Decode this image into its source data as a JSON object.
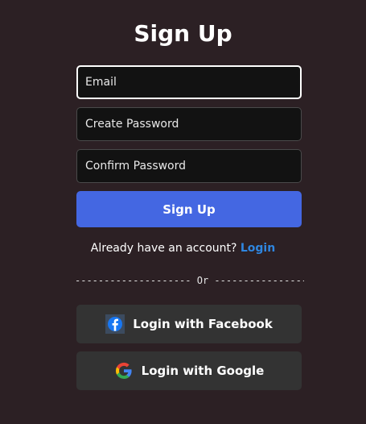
{
  "title": "Sign Up",
  "form": {
    "email_placeholder": "Email",
    "password_placeholder": "Create Password",
    "confirm_placeholder": "Confirm Password",
    "submit_label": "Sign Up"
  },
  "account": {
    "prompt": "Already have an account?",
    "login_link": "Login"
  },
  "divider": {
    "left": "--------------------",
    "text": "Or",
    "right": "--------------------"
  },
  "social": {
    "facebook_label": "Login with Facebook",
    "facebook_icon": "facebook-icon",
    "google_label": "Login with Google",
    "google_icon": "google-icon"
  },
  "colors": {
    "background": "#2c2024",
    "primary": "#4467e2",
    "link": "#2f86e0",
    "social_button": "#333333",
    "input_background": "#121212"
  }
}
